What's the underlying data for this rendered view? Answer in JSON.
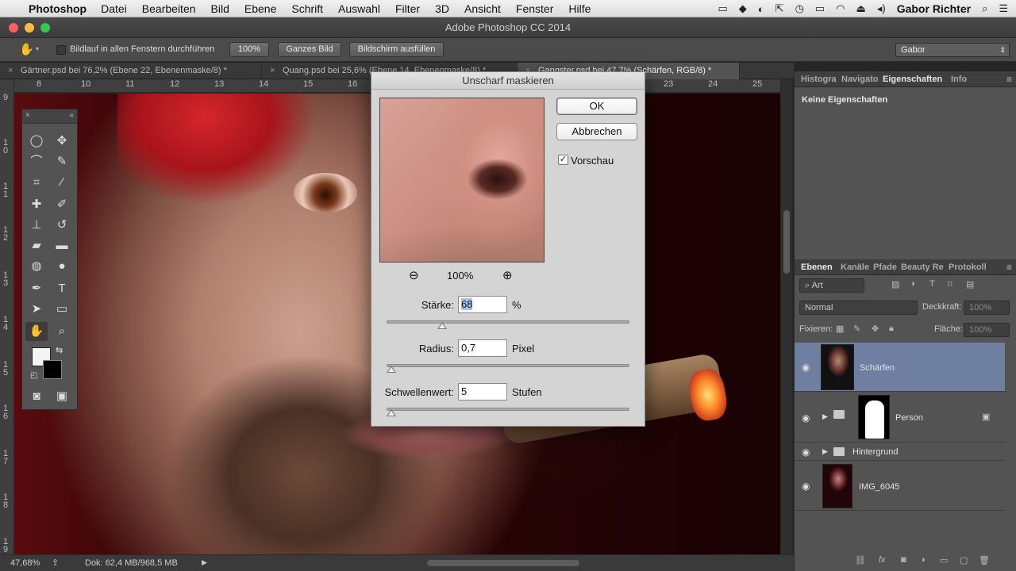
{
  "menubar": {
    "app": "Photoshop",
    "items": [
      "Datei",
      "Bearbeiten",
      "Bild",
      "Ebene",
      "Schrift",
      "Auswahl",
      "Filter",
      "3D",
      "Ansicht",
      "Fenster",
      "Hilfe"
    ],
    "user": "Gabor Richter"
  },
  "window": {
    "title": "Adobe Photoshop CC 2014"
  },
  "options": {
    "scroll_all_label": "Bildlauf in allen Fenstern durchführen",
    "zoom_100": "100%",
    "fit_screen": "Ganzes Bild",
    "fill_screen": "Bildschirm ausfüllen",
    "workspace": "Gabor"
  },
  "doc_tabs": [
    {
      "label": "Gärtner.psd bei 76,2% (Ebene 22, Ebenenmaske/8) *"
    },
    {
      "label": "Quang.psd bei 25,6% (Ebene 14, Ebenenmaske/8) *"
    },
    {
      "label": "Gangster.psd bei 47,7% (Schärfen, RGB/8) *"
    }
  ],
  "ruler": {
    "h": [
      "8",
      "10",
      "11",
      "12",
      "13",
      "14",
      "15",
      "16",
      "23",
      "24",
      "25"
    ],
    "v": [
      "9",
      "1\n0",
      "1\n1",
      "1\n2",
      "1\n3",
      "1\n4",
      "1\n5",
      "1\n6",
      "1\n7",
      "1\n8",
      "1\n9"
    ]
  },
  "dialog": {
    "title": "Unscharf maskieren",
    "ok": "OK",
    "cancel": "Abbrechen",
    "preview_label": "Vorschau",
    "preview_checked": true,
    "zoom": "100%",
    "amount_label": "Stärke:",
    "amount_value": "68",
    "amount_unit": "%",
    "amount_fraction": 0.23,
    "radius_label": "Radius:",
    "radius_value": "0,7",
    "radius_unit": "Pixel",
    "radius_fraction": 0.02,
    "threshold_label": "Schwellenwert:",
    "threshold_value": "5",
    "threshold_unit": "Stufen",
    "threshold_fraction": 0.02
  },
  "props_panel": {
    "tabs": [
      "Histogra",
      "Navigato",
      "Eigenschaften",
      "Info"
    ],
    "active": "Eigenschaften",
    "content": "Keine Eigenschaften"
  },
  "layers_panel": {
    "tabs": [
      "Ebenen",
      "Kanäle",
      "Pfade",
      "Beauty Re",
      "Protokoll"
    ],
    "filter": "Art",
    "blend_mode": "Normal",
    "opacity_label": "Deckkraft:",
    "opacity": "100%",
    "lock_label": "Fixieren:",
    "fill_label": "Fläche:",
    "fill": "100%",
    "layers": [
      {
        "name": "Schärfen",
        "selected": true
      },
      {
        "name": "Person",
        "selected": false
      },
      {
        "name": "Hintergrund",
        "selected": false
      },
      {
        "name": "IMG_6045",
        "selected": false
      }
    ]
  },
  "status": {
    "zoom": "47,68%",
    "doc": "Dok: 62,4 MB/968,5 MB"
  },
  "icons": {
    "hand_tool": "hand-icon",
    "zoom_out": "zoom-out-icon",
    "zoom_in": "zoom-in-icon",
    "eye": "eye-icon"
  }
}
